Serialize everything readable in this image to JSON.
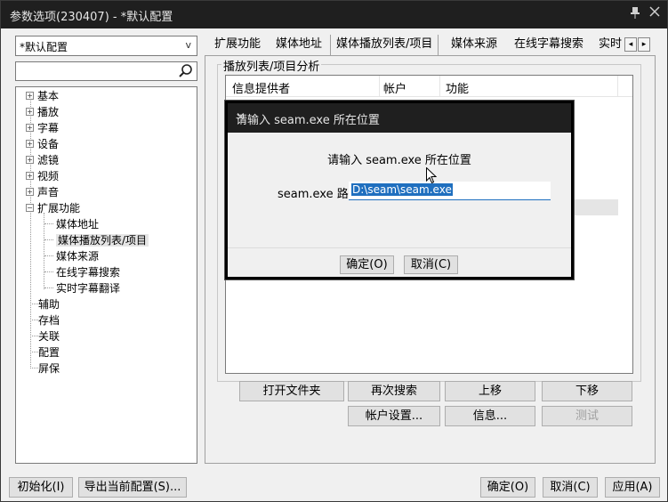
{
  "window": {
    "title": "参数选项(230407) - *默认配置",
    "pin_icon": "pin-icon",
    "close_icon": "close-icon"
  },
  "left": {
    "profile_value": "*默认配置",
    "profile_arrow": "v",
    "search_placeholder": "",
    "tree": [
      {
        "label": "基本",
        "level": 0,
        "expandable": true
      },
      {
        "label": "播放",
        "level": 0,
        "expandable": true
      },
      {
        "label": "字幕",
        "level": 0,
        "expandable": true
      },
      {
        "label": "设备",
        "level": 0,
        "expandable": true
      },
      {
        "label": "滤镜",
        "level": 0,
        "expandable": true
      },
      {
        "label": "视频",
        "level": 0,
        "expandable": true
      },
      {
        "label": "声音",
        "level": 0,
        "expandable": true
      },
      {
        "label": "扩展功能",
        "level": 0,
        "expandable": true,
        "expanded": true
      },
      {
        "label": "媒体地址",
        "level": 1
      },
      {
        "label": "媒体播放列表/项目",
        "level": 1,
        "selected": true
      },
      {
        "label": "媒体来源",
        "level": 1
      },
      {
        "label": "在线字幕搜索",
        "level": 1
      },
      {
        "label": "实时字幕翻译",
        "level": 1
      },
      {
        "label": "辅助",
        "level": 0
      },
      {
        "label": "存档",
        "level": 0
      },
      {
        "label": "关联",
        "level": 0
      },
      {
        "label": "配置",
        "level": 0
      },
      {
        "label": "屏保",
        "level": 0
      }
    ]
  },
  "tabs": [
    "扩展功能",
    "媒体地址",
    "媒体播放列表/项目",
    "媒体来源",
    "在线字幕搜索",
    "实时"
  ],
  "tab_scroll": {
    "left": "◂",
    "right": "▸"
  },
  "group": {
    "label": "播放列表/项目分析",
    "columns": [
      "信息提供者",
      "帐户",
      "功能"
    ]
  },
  "buttons": {
    "open_folder": "打开文件夹",
    "search_again": "再次搜索",
    "move_up": "上移",
    "move_down": "下移",
    "account_settings": "帐户设置...",
    "info": "信息...",
    "test": "测试"
  },
  "footer": {
    "initialize": "初始化(I)",
    "export": "导出当前配置(S)...",
    "ok": "确定(O)",
    "cancel": "取消(C)",
    "apply": "应用(A)"
  },
  "dialog": {
    "title": "请输入 seam.exe 所在位置",
    "close": "×",
    "prompt": "请输入 seam.exe 所在位置",
    "path_label": "seam.exe 路径",
    "path_value": "D:\\seam\\seam.exe",
    "ok": "确定(O)",
    "cancel": "取消(C)"
  }
}
